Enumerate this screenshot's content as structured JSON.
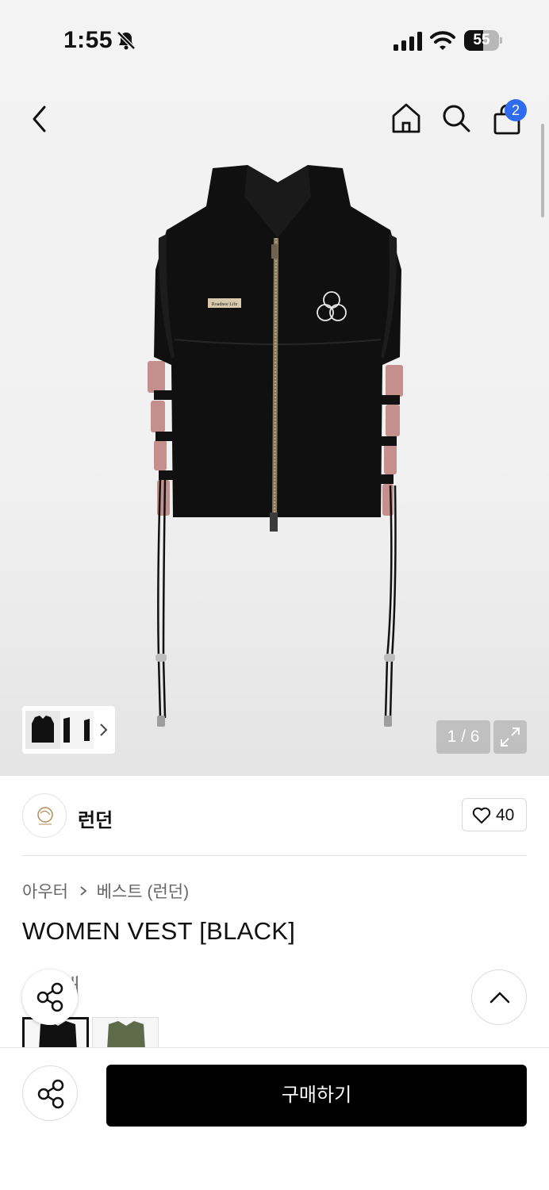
{
  "status_bar": {
    "time": "1:55",
    "battery": "55"
  },
  "header": {
    "cart_count": "2"
  },
  "gallery": {
    "counter": "1 / 6",
    "logo_patch_text": "Roadnee Life"
  },
  "brand": {
    "name": "런던",
    "likes": "40"
  },
  "product": {
    "breadcrumb": [
      "아우터",
      "베스트 (런던)"
    ],
    "title": "WOMEN VEST [BLACK]",
    "peek_label": "개"
  },
  "actions": {
    "buy_label": "구매하기"
  },
  "colors": {
    "badge": "#2f6bf0",
    "buy_button": "#000000",
    "vest_trim": "#c48f8c"
  }
}
